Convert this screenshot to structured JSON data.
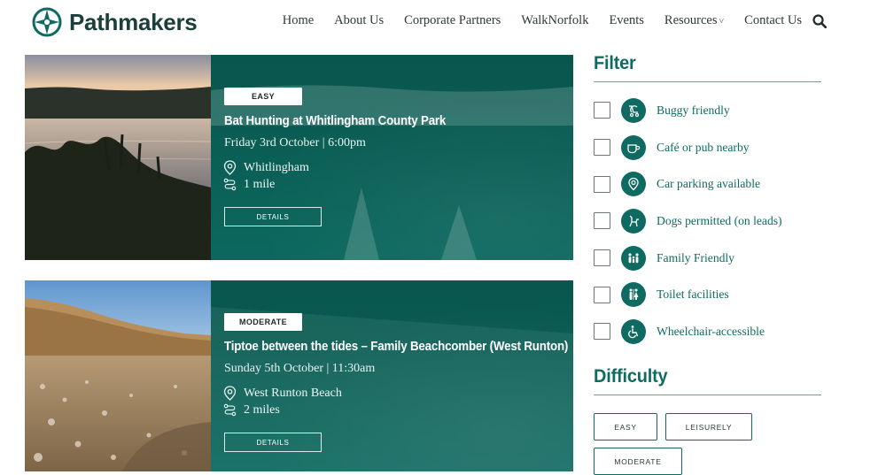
{
  "brand": {
    "name": "Pathmakers"
  },
  "nav": {
    "items": [
      "Home",
      "About Us",
      "Corporate Partners",
      "WalkNorfolk",
      "Events",
      "Resources",
      "Contact Us"
    ],
    "resources_caret": "˅"
  },
  "cards": [
    {
      "badge": "EASY",
      "title": "Bat Hunting at Whitlingham County Park",
      "date": "Friday 3rd October | 6:00pm",
      "location": "Whitlingham",
      "distance": "1 mile",
      "button": "DETAILS"
    },
    {
      "badge": "MODERATE",
      "title": "Tiptoe between the tides – Family Beachcomber (West Runton)",
      "date": "Sunday 5th October | 11:30am",
      "location": "West Runton Beach",
      "distance": "2 miles",
      "button": "DETAILS"
    }
  ],
  "filter": {
    "title": "Filter",
    "items": [
      {
        "label": "Buggy friendly",
        "icon": "buggy-icon"
      },
      {
        "label": "Café or pub nearby",
        "icon": "cup-icon"
      },
      {
        "label": "Car parking available",
        "icon": "parking-pin-icon"
      },
      {
        "label": "Dogs permitted (on leads)",
        "icon": "dog-icon"
      },
      {
        "label": "Family Friendly",
        "icon": "family-icon"
      },
      {
        "label": "Toilet facilities",
        "icon": "toilet-icon"
      },
      {
        "label": "Wheelchair-accessible",
        "icon": "wheelchair-icon"
      }
    ]
  },
  "difficulty": {
    "title": "Difficulty",
    "options": [
      "EASY",
      "LEISURELY",
      "MODERATE"
    ]
  },
  "colors": {
    "accent": "#0f6b61",
    "card_bg": "#0b5a51"
  }
}
